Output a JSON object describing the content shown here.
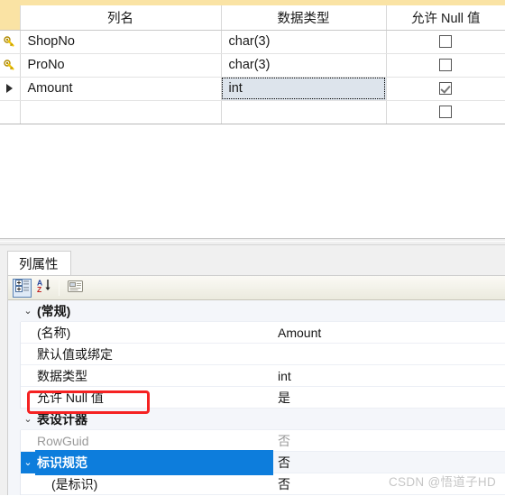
{
  "designer_grid": {
    "headers": {
      "selector": "",
      "column_name": "列名",
      "data_type": "数据类型",
      "allow_nulls": "允许 Null 值"
    },
    "rows": [
      {
        "marker": "key-icon",
        "column_name": "ShopNo",
        "data_type": "char(3)",
        "allow_nulls": false,
        "focused": false
      },
      {
        "marker": "key-icon",
        "column_name": "ProNo",
        "data_type": "char(3)",
        "allow_nulls": false,
        "focused": false
      },
      {
        "marker": "row-pointer-icon",
        "column_name": "Amount",
        "data_type": "int",
        "allow_nulls": true,
        "focused": true
      },
      {
        "marker": "",
        "column_name": "",
        "data_type": "",
        "allow_nulls": false,
        "focused": false
      }
    ]
  },
  "properties_pane": {
    "tab_label": "列属性",
    "toolbar": {
      "categorized_label": "按分类顺序",
      "alphabetical_label": "按字母顺序",
      "property_pages_label": "属性页"
    },
    "rows": [
      {
        "kind": "category",
        "name": "(常规)",
        "value": "",
        "expander": "⌄",
        "dim": false,
        "selected": false,
        "indent": false
      },
      {
        "kind": "prop",
        "name": "(名称)",
        "value": "Amount",
        "expander": "",
        "dim": false,
        "selected": false,
        "indent": false
      },
      {
        "kind": "prop",
        "name": "默认值或绑定",
        "value": "",
        "expander": "",
        "dim": false,
        "selected": false,
        "indent": false
      },
      {
        "kind": "prop",
        "name": "数据类型",
        "value": "int",
        "expander": "",
        "dim": false,
        "selected": false,
        "indent": false
      },
      {
        "kind": "prop",
        "name": "允许 Null 值",
        "value": "是",
        "expander": "",
        "dim": false,
        "selected": false,
        "indent": false
      },
      {
        "kind": "category",
        "name": "表设计器",
        "value": "",
        "expander": "⌄",
        "dim": false,
        "selected": false,
        "indent": false
      },
      {
        "kind": "prop",
        "name": "RowGuid",
        "value": "否",
        "expander": "",
        "dim": true,
        "selected": false,
        "indent": false
      },
      {
        "kind": "category",
        "name": "标识规范",
        "value": "否",
        "expander": "⌄",
        "dim": false,
        "selected": true,
        "indent": false
      },
      {
        "kind": "prop",
        "name": "(是标识)",
        "value": "否",
        "expander": "",
        "dim": false,
        "selected": false,
        "indent": true
      }
    ]
  },
  "annotation": {
    "target_label": "允许 Null 值",
    "color": "#f52222"
  },
  "watermark": {
    "text": "CSDN @悟道子HD",
    "color": "#c6c6c6"
  },
  "colors": {
    "header_band": "#fae3a4",
    "focus_cell_bg": "#dde4ec",
    "selection_blue": "#0d7ddc",
    "key_icon_gold": "#f2c500"
  }
}
